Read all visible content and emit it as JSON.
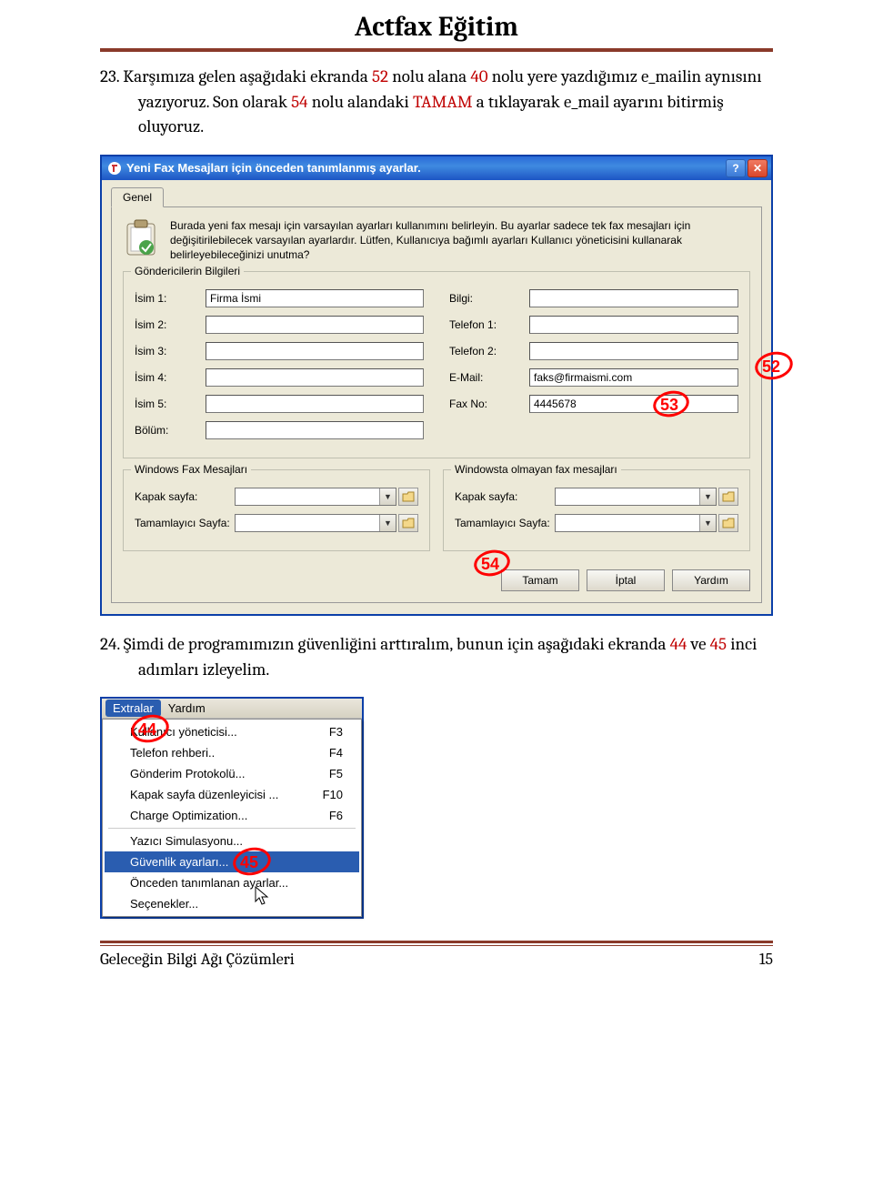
{
  "header": {
    "title": "Actfax Eğitim"
  },
  "para23": {
    "prefix": "23.",
    "t1": " Karşımıza gelen aşağıdaki ekranda ",
    "n1": "52",
    "t2": " nolu alana ",
    "n2": "40",
    "t3": " nolu yere yazdığımız e_mailin aynısını yazıyoruz. Son olarak ",
    "n3": "54",
    "t4": " nolu alandaki ",
    "n4": "TAMAM",
    "t5": " a tıklayarak e_mail ayarını bitirmiş oluyoruz."
  },
  "dialog": {
    "title": "Yeni Fax Mesajları için önceden tanımlanmış ayarlar.",
    "tab": "Genel",
    "intro": "Burada yeni fax mesajı için varsayılan ayarları kullanımını belirleyin. Bu ayarlar sadece tek fax mesajları için değişitirilebilecek varsayılan ayarlardır. Lütfen, Kullanıcıya bağımlı ayarları Kullanıcı yöneticisini kullanarak belirleyebileceğinizi unutma?",
    "sender_group": "Göndericilerin Bilgileri",
    "labels": {
      "isim1": "İsim 1:",
      "isim2": "İsim 2:",
      "isim3": "İsim 3:",
      "isim4": "İsim 4:",
      "isim5": "İsim 5:",
      "bolum": "Bölüm:",
      "bilgi": "Bilgi:",
      "tel1": "Telefon 1:",
      "tel2": "Telefon 2:",
      "email": "E-Mail:",
      "faxno": "Fax No:"
    },
    "values": {
      "isim1": "Firma İsmi",
      "email": "faks@firmaismi.com",
      "faxno": "4445678"
    },
    "group_win": "Windows Fax Mesajları",
    "group_nonwin": "Windowsta olmayan fax mesajları",
    "kapak": "Kapak sayfa:",
    "tamamlayici": "Tamamlayıcı Sayfa:",
    "btn_ok": "Tamam",
    "btn_cancel": "İptal",
    "btn_help": "Yardım",
    "annot": {
      "a52": "52",
      "a53": "53",
      "a54": "54"
    }
  },
  "para24": {
    "prefix": "24.",
    "t1": " Şimdi de programımızın güvenliğini arttıralım, bunun için aşağıdaki ekranda ",
    "n1": "44",
    "t2": " ve ",
    "n2": "45",
    "t3": " inci adımları izleyelim."
  },
  "menu": {
    "bar": {
      "extralar": "Extralar",
      "yardim": "Yardım"
    },
    "items": [
      {
        "label": "Kullanıcı yöneticisi...",
        "sc": "F3"
      },
      {
        "label": "Telefon rehberi..",
        "sc": "F4"
      },
      {
        "label": "Gönderim Protokolü...",
        "sc": "F5"
      },
      {
        "label": "Kapak sayfa düzenleyicisi ...",
        "sc": "F10"
      },
      {
        "label": "Charge Optimization...",
        "sc": "F6"
      }
    ],
    "items2": [
      {
        "label": "Yazıcı Simulasyonu..."
      },
      {
        "label": "Güvenlik ayarları..."
      },
      {
        "label": "Önceden tanımlanan ayarlar..."
      },
      {
        "label": "Seçenekler..."
      }
    ],
    "annot": {
      "a44": "44",
      "a45": "45"
    }
  },
  "footer": {
    "left": "Geleceğin Bilgi Ağı Çözümleri",
    "right": "15"
  }
}
